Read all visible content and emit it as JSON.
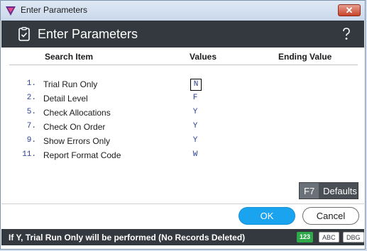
{
  "window": {
    "title": "Enter Parameters",
    "close_glyph": "✕"
  },
  "header": {
    "title": "Enter Parameters",
    "help_glyph": "?"
  },
  "columns": {
    "search_item": "Search Item",
    "values": "Values",
    "ending_value": "Ending Value"
  },
  "rows": [
    {
      "num": "1.",
      "label": "Trial Run Only",
      "value": "N"
    },
    {
      "num": "2.",
      "label": "Detail Level",
      "value": "F"
    },
    {
      "num": "5.",
      "label": "Check Allocations",
      "value": "Y"
    },
    {
      "num": "7.",
      "label": "Check On Order",
      "value": "Y"
    },
    {
      "num": "9.",
      "label": "Show Errors Only",
      "value": "Y"
    },
    {
      "num": "11.",
      "label": "Report Format Code",
      "value": "W"
    }
  ],
  "defaults_button": {
    "key": "F7",
    "label": "Defaults"
  },
  "buttons": {
    "ok": "OK",
    "cancel": "Cancel"
  },
  "status": {
    "message": "If Y, Trial Run Only will be performed (No Records Deleted)",
    "badges": [
      "123",
      "ABC",
      "DBG"
    ]
  },
  "colors": {
    "header_bg": "#34393f",
    "ok_bg": "#1aa4f0",
    "badge_green": "#2faa4a",
    "close_red": "#c7432b"
  },
  "icons": {
    "app": "app-logo-icon",
    "header": "checklist-icon",
    "help": "help-icon",
    "close": "close-icon"
  }
}
